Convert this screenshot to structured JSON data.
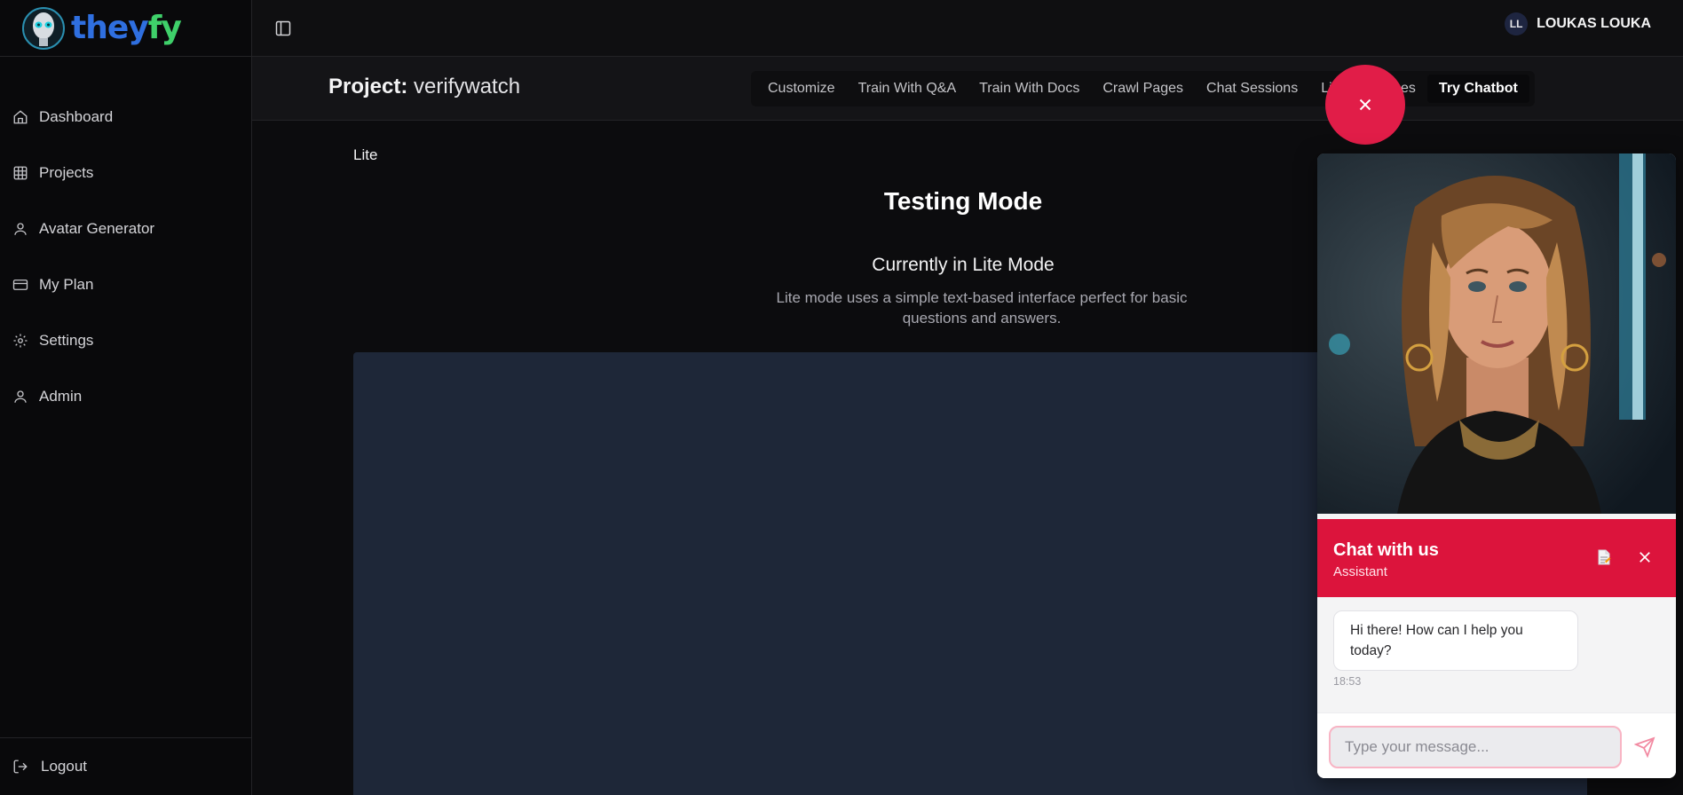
{
  "brand": {
    "part1": "they",
    "part2": "fy"
  },
  "sidebar": {
    "items": [
      {
        "label": "Dashboard",
        "icon": "home-icon"
      },
      {
        "label": "Projects",
        "icon": "grid-icon"
      },
      {
        "label": "Avatar Generator",
        "icon": "user-icon"
      },
      {
        "label": "My Plan",
        "icon": "credit-card-icon"
      },
      {
        "label": "Settings",
        "icon": "gear-icon"
      },
      {
        "label": "Admin",
        "icon": "user-icon"
      }
    ],
    "logout": "Logout"
  },
  "header": {
    "user_initials": "LL",
    "user_name": "LOUKAS LOUKA"
  },
  "project": {
    "label": "Project:",
    "name": "verifywatch",
    "tabs": [
      {
        "label": "Customize",
        "active": false
      },
      {
        "label": "Train With Q&A",
        "active": false
      },
      {
        "label": "Train With Docs",
        "active": false
      },
      {
        "label": "Crawl Pages",
        "active": false
      },
      {
        "label": "Chat Sessions",
        "active": false
      },
      {
        "label": "Live Messages",
        "active": false
      },
      {
        "label": "Try Chatbot",
        "active": true
      }
    ]
  },
  "main": {
    "mode_label": "Lite",
    "title": "Testing Mode",
    "current_mode": "Currently in Lite Mode",
    "description": "Lite mode uses a simple text-based interface perfect for basic questions and answers."
  },
  "widget": {
    "title": "Chat with us",
    "subtitle": "Assistant",
    "messages": [
      {
        "text": "Hi there! How can I help you today?",
        "time": "18:53"
      }
    ],
    "input_placeholder": "Type your message...",
    "accent": "#dc143c"
  },
  "colors": {
    "brand_blue": "#2f6fe0",
    "brand_green": "#3fd06a",
    "fab": "#e11d48"
  }
}
